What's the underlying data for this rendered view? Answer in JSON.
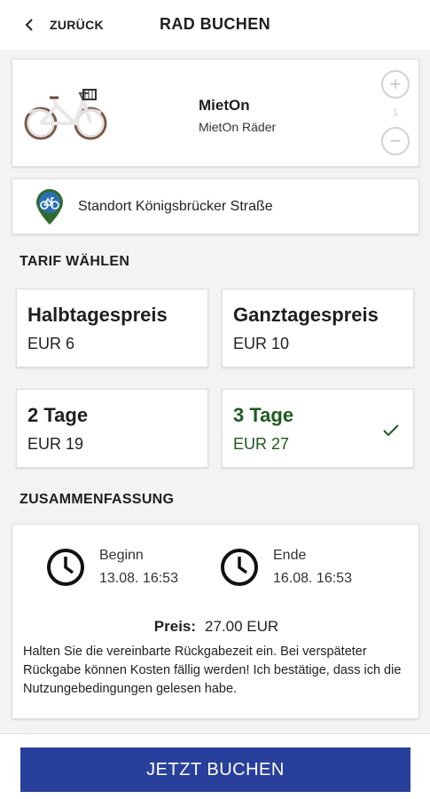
{
  "header": {
    "back_label": "ZURÜCK",
    "title": "RAD BUCHEN"
  },
  "bike": {
    "name": "MietOn",
    "provider": "MietOn Räder",
    "quantity": "1",
    "plus_symbol": "+",
    "minus_symbol": "−",
    "image_icon": "bicycle-illustration"
  },
  "location": {
    "label": "Standort Königsbrücker Straße",
    "icon": "bike-location-pin-icon",
    "pin_color": "#2f6b2f",
    "pin_inner_color": "#2b6fb3"
  },
  "tariff_section": {
    "title": "TARIF WÄHLEN",
    "options": [
      {
        "name": "Halbtagespreis",
        "price": "EUR 6"
      },
      {
        "name": "Ganztagespreis",
        "price": "EUR 10"
      },
      {
        "name": "2 Tage",
        "price": "EUR 19"
      },
      {
        "name": "3 Tage",
        "price": "EUR 27"
      }
    ],
    "selected_index": 3,
    "selected_color": "#1e5b1f"
  },
  "summary": {
    "title": "ZUSAMMENFASSUNG",
    "begin_label": "Beginn",
    "begin_value": "13.08. 16:53",
    "end_label": "Ende",
    "end_value": "16.08. 16:53",
    "price_label": "Preis:",
    "price_value": "27.00 EUR",
    "note": "Halten Sie die vereinbarte Rückgabezeit ein. Bei verspäteter Rückgabe können Kosten fällig werden! Ich bestätige, dass ich die Nutzungebedingungen gelesen habe."
  },
  "action": {
    "book_label": "JETZT BUCHEN",
    "button_color": "#283f9c"
  }
}
